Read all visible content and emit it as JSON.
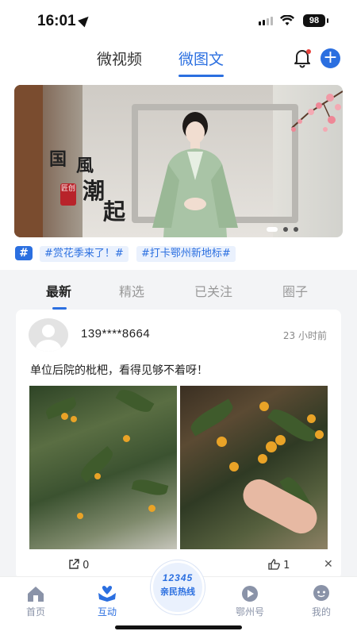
{
  "status_bar": {
    "time": "16:01",
    "battery": "98"
  },
  "top_nav": {
    "tabs": [
      {
        "label": "微视频"
      },
      {
        "label": "微图文",
        "active": true
      }
    ]
  },
  "banner": {
    "calligraphy": [
      "国",
      "風",
      "潮",
      "起"
    ],
    "seal": "匠创",
    "page_count": 3,
    "active_page": 1
  },
  "hashtags": [
    "#赏花季来了！#",
    "#打卡鄂州新地标#"
  ],
  "feed_tabs": [
    "最新",
    "精选",
    "已关注",
    "圈子"
  ],
  "post": {
    "username": "139****8664",
    "time": "23 小时前",
    "text": "单位后院的枇杷，看得见够不着呀！",
    "share_count": "0",
    "like_count": "1"
  },
  "bottom_nav": {
    "items": [
      {
        "label": "首页",
        "icon": "home-icon"
      },
      {
        "label": "互动",
        "icon": "heart-hands-icon",
        "active": true
      },
      {
        "label": "鄂州号",
        "icon": "play-circle-icon"
      },
      {
        "label": "我的",
        "icon": "user-icon"
      }
    ],
    "hotline": {
      "number": "12345",
      "label": "亲民热线"
    }
  },
  "colors": {
    "accent": "#2b6fe0",
    "inactive": "#8a93a8"
  }
}
